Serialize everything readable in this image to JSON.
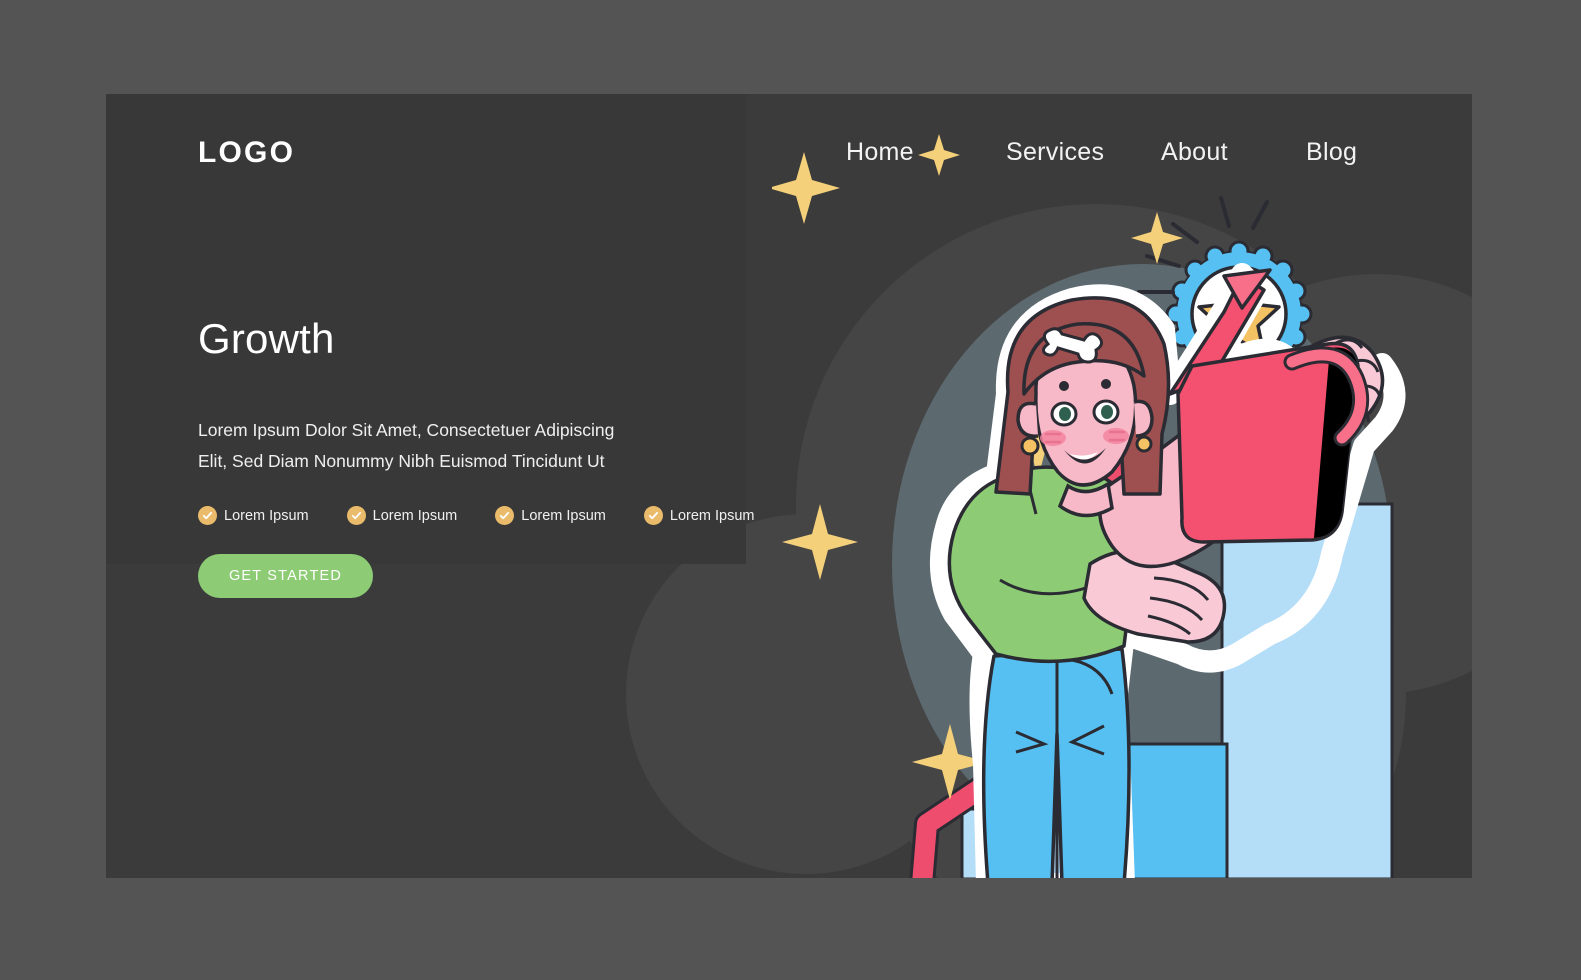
{
  "page": {
    "background_color": "#545454",
    "card_color": "#3b3b3b",
    "panel_color": "#383838"
  },
  "header": {
    "logo": "LOGO",
    "nav": [
      {
        "label": "Home",
        "name": "nav-item-home"
      },
      {
        "label": "Services",
        "name": "nav-item-services"
      },
      {
        "label": "About",
        "name": "nav-item-about"
      },
      {
        "label": "Blog",
        "name": "nav-item-blog"
      }
    ]
  },
  "hero": {
    "title": "Growth",
    "subtitle": "Lorem Ipsum Dolor Sit Amet, Consectetuer Adipiscing Elit, Sed Diam Nonummy Nibh Euismod Tincidunt Ut",
    "features": [
      {
        "label": "Lorem Ipsum",
        "icon": "check-circle-icon"
      },
      {
        "label": "Lorem Ipsum",
        "icon": "check-circle-icon"
      },
      {
        "label": "Lorem Ipsum",
        "icon": "check-circle-icon"
      },
      {
        "label": "Lorem Ipsum",
        "icon": "check-circle-icon"
      }
    ],
    "cta_label": "GET STARTED",
    "cta_color": "#8dcc75",
    "check_color": "#e9bb6b"
  },
  "illustration": {
    "name": "growth-illustration",
    "description": "Woman watering a growing bar chart with a watering can, award rosette badge, rising arrow",
    "colors": {
      "backdrop_oval": "#5c6a70",
      "skin": "#f7b8c8",
      "skin_light": "#f9c9d6",
      "hair": "#9e4f4f",
      "shirt": "#8dcc75",
      "jeans": "#56c0f2",
      "watering_can": "#f4506f",
      "watering_can_light": "#f86f8a",
      "arrow": "#ee4d6e",
      "bar_light": "#b4ddf8",
      "bar_mid": "#56c0f2",
      "badge_ring": "#56c0f2",
      "badge_star": "#f5c263",
      "ribbon": "#8dcc75",
      "sparkle": "#f5d07a",
      "outline": "#2b2b33",
      "sticker_outline": "#ffffff"
    }
  }
}
